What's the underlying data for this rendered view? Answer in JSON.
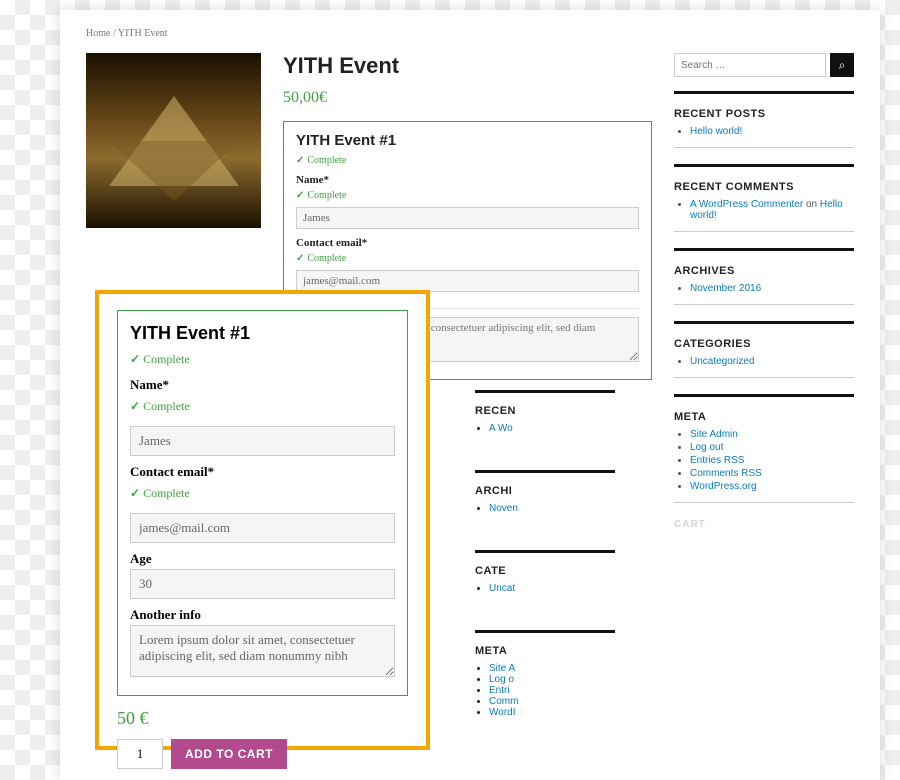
{
  "breadcrumb": {
    "home": "Home",
    "sep": "/",
    "current": "YITH Event"
  },
  "product": {
    "title": "YITH Event",
    "price": "50,00€"
  },
  "event_panel": {
    "title": "YITH Event #1",
    "status": "Complete",
    "name_label": "Name*",
    "name_value": "James",
    "email_label": "Contact email*",
    "email_value": "james@mail.com",
    "info_placeholder": "Lorem ipsum dolor sit amet, consectetuer adipiscing elit, sed diam nonummy nibh"
  },
  "cart": {
    "qty": "1",
    "button": "ADD TO CART",
    "partial_button": "D TO CART"
  },
  "sidebar": {
    "search_placeholder": "Search …",
    "recent_posts": {
      "title": "RECENT POSTS",
      "items": [
        "Hello world!"
      ]
    },
    "recent_comments": {
      "title": "RECENT COMMENTS",
      "author": "A WordPress Commenter",
      "on": "on",
      "post": "Hello world!"
    },
    "archives": {
      "title": "ARCHIVES",
      "items": [
        "November 2016"
      ]
    },
    "categories": {
      "title": "CATEGORIES",
      "items": [
        "Uncategorized"
      ]
    },
    "meta": {
      "title": "META",
      "items": [
        "Site Admin",
        "Log out",
        "Entries RSS",
        "Comments RSS",
        "WordPress.org"
      ]
    },
    "cart_label": "CART"
  },
  "popup": {
    "title": "YITH Event #1",
    "status": "Complete",
    "name_label": "Name*",
    "name_value": "James",
    "email_label": "Contact email*",
    "email_value": "james@mail.com",
    "age_label": "Age",
    "age_value": "30",
    "info_label": "Another info",
    "info_value": "Lorem ipsum dolor sit amet, consectetuer adipiscing elit, sed diam nonummy nibh",
    "price": "50 €"
  },
  "bg_widgets": {
    "recent_posts": {
      "title": "RECEN",
      "item": "A Wo"
    },
    "archives": {
      "title": "ARCHI",
      "item": "Noven"
    },
    "categories": {
      "title": "CATE",
      "item": "Uncat"
    },
    "meta": {
      "title": "META",
      "items": [
        "Site A",
        "Log o",
        "Entri",
        "Comm",
        "WordI"
      ]
    }
  }
}
